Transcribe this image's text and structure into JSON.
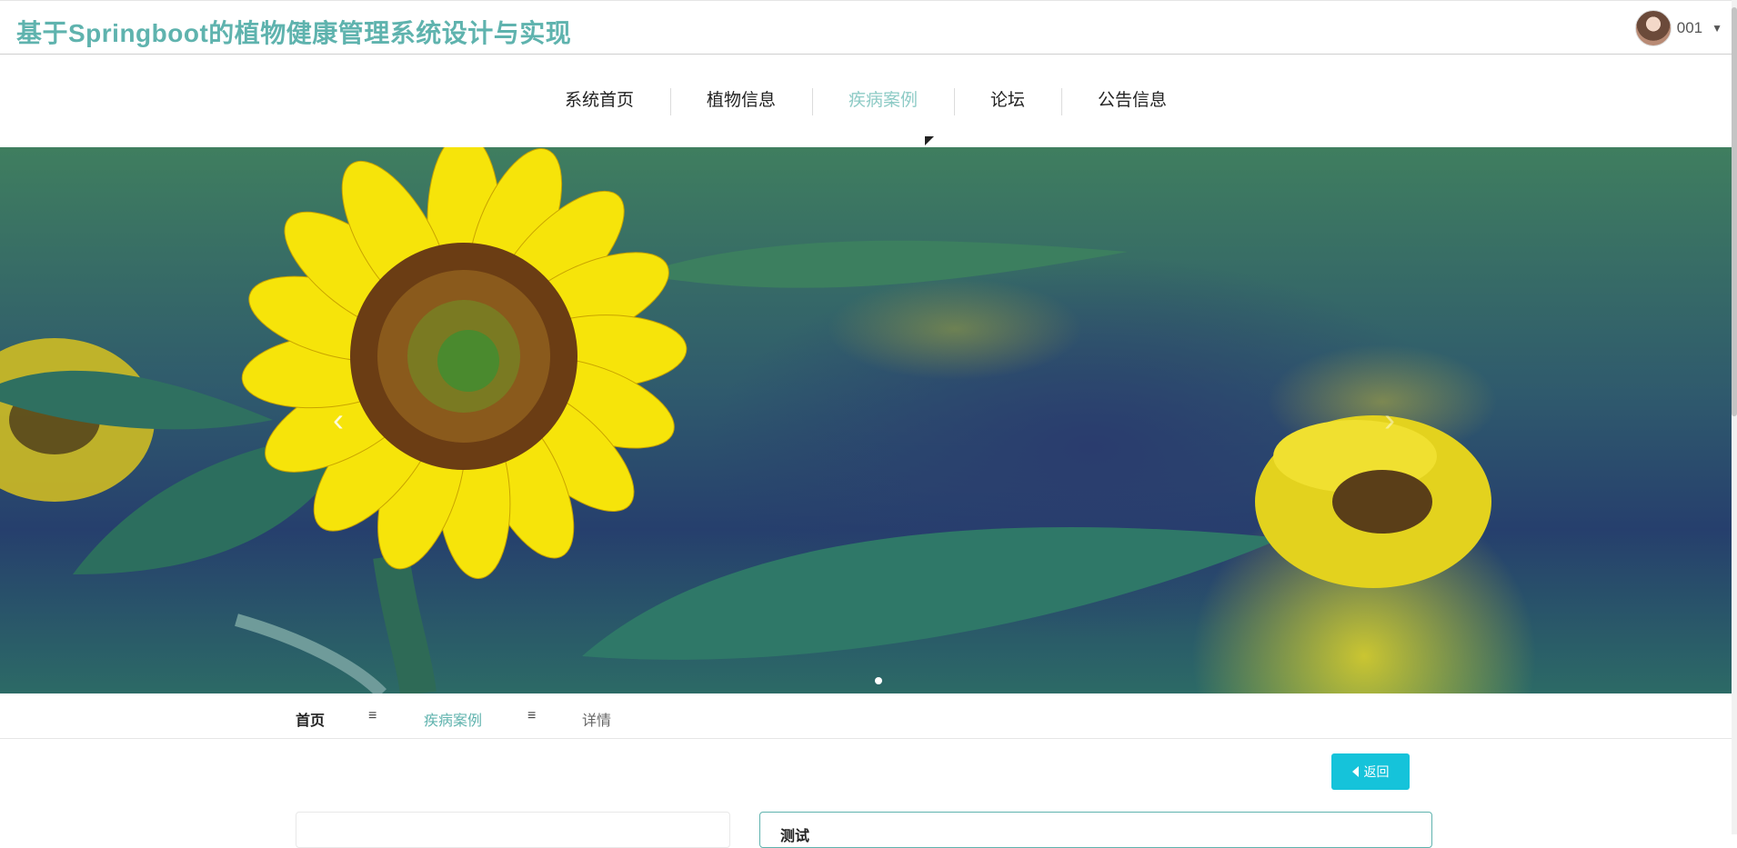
{
  "header": {
    "title": "基于Springboot的植物健康管理系统设计与实现",
    "username": "001"
  },
  "nav": {
    "items": [
      {
        "label": "系统首页"
      },
      {
        "label": "植物信息"
      },
      {
        "label": "疾病案例"
      },
      {
        "label": "论坛"
      },
      {
        "label": "公告信息"
      }
    ],
    "active_index": 2,
    "active_color": "#8ecbc6"
  },
  "carousel": {
    "prev_glyph": "‹",
    "next_glyph": "›",
    "slide_count": 1,
    "active_slide": 0
  },
  "breadcrumb": {
    "home": "首页",
    "separator": "≡",
    "category": "疾病案例",
    "current": "详情"
  },
  "actions": {
    "back_label": "返回"
  },
  "detail": {
    "title": "测试"
  },
  "colors": {
    "brand": "#5fb3ae",
    "back_button": "#15c3da"
  }
}
